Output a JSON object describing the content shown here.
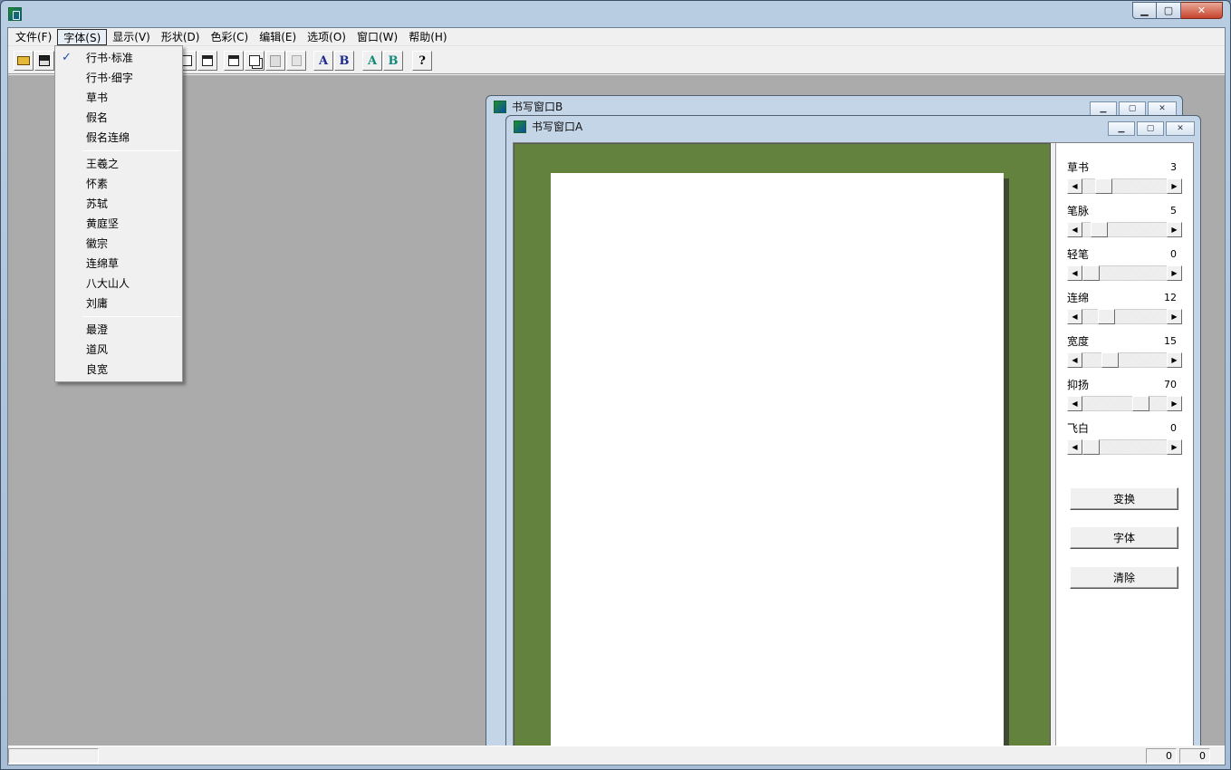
{
  "menubar": {
    "items": [
      "文件(F)",
      "字体(S)",
      "显示(V)",
      "形状(D)",
      "色彩(C)",
      "编辑(E)",
      "选项(O)",
      "窗口(W)",
      "帮助(H)"
    ]
  },
  "toolbar": {
    "font_a": "A",
    "font_b": "B",
    "color_a": "A",
    "color_b": "B",
    "help": "?"
  },
  "font_menu": {
    "group1": [
      "行书·标准",
      "行书·细字",
      "草书",
      "假名",
      "假名连绵"
    ],
    "group2": [
      "王羲之",
      "怀素",
      "苏轼",
      "黄庭坚",
      "徽宗",
      "连绵草",
      "八大山人",
      "刘庸"
    ],
    "group3": [
      "最澄",
      "道风",
      "良宽"
    ],
    "checked": "行书·标准",
    "check_mark": "✓"
  },
  "window_b": {
    "title": "书写窗口B"
  },
  "window_a": {
    "title": "书写窗口A",
    "params": [
      {
        "label": "草书",
        "value": "3"
      },
      {
        "label": "笔脉",
        "value": "5"
      },
      {
        "label": "轻笔",
        "value": "0"
      },
      {
        "label": "连绵",
        "value": "12"
      },
      {
        "label": "宽度",
        "value": "15"
      },
      {
        "label": "抑扬",
        "value": "70"
      },
      {
        "label": "飞白",
        "value": "0"
      }
    ],
    "param_positions": [
      0.18,
      0.12,
      0.0,
      0.22,
      0.28,
      0.72,
      0.0
    ],
    "buttons": {
      "transform": "变换",
      "font": "字体",
      "clear": "清除"
    }
  },
  "statusbar": {
    "pane1": "",
    "pane2": "0",
    "pane3": "0"
  },
  "colors": {
    "canvas_bg": "#62823d",
    "paper": "#ffffff",
    "mdi_bg": "#ababab",
    "check": "#1b4ea8"
  }
}
